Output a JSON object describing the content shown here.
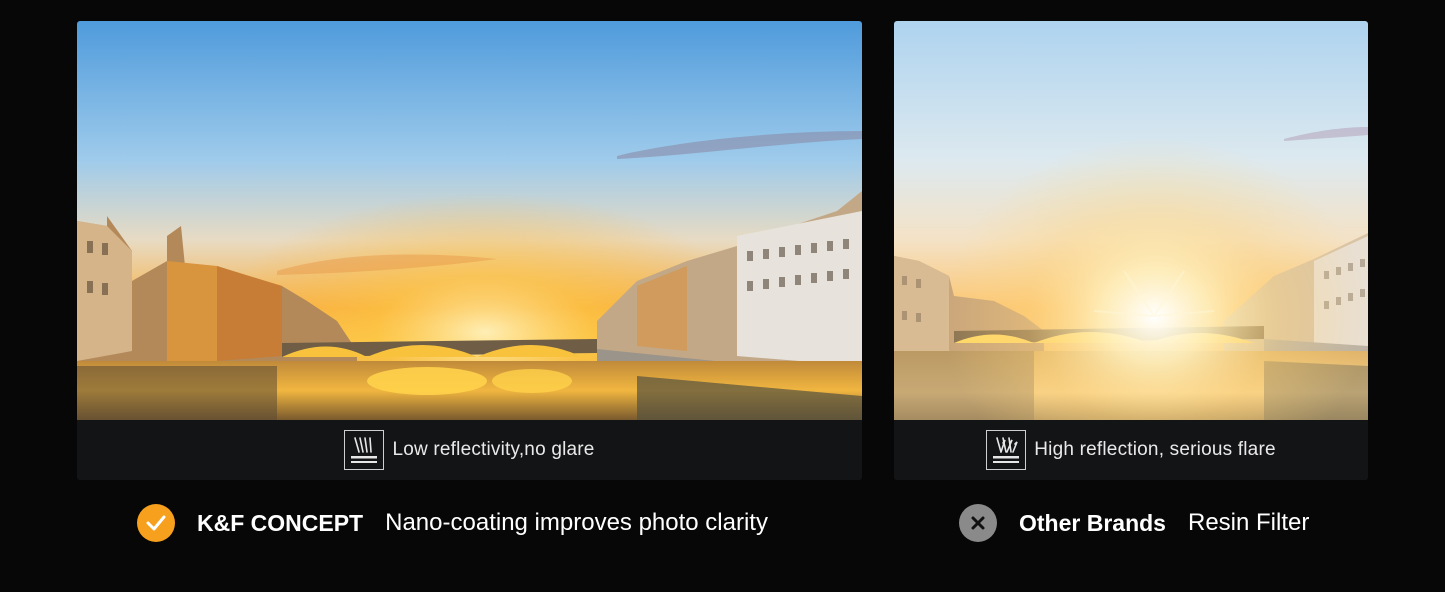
{
  "left_panel": {
    "image_alt": "City riverside at sunset with arched bridge, clear reflections",
    "caption_icon": "low-reflection-icon",
    "caption": "Low reflectivity,no glare"
  },
  "right_panel": {
    "image_alt": "City riverside at sunset with heavy flare and washed-out sky",
    "caption_icon": "high-reflection-icon",
    "caption": "High reflection, serious flare"
  },
  "bottom_left": {
    "icon": "check-icon",
    "brand": "K&F CONCEPT",
    "description": "Nano-coating improves photo clarity"
  },
  "bottom_right": {
    "icon": "cross-icon",
    "brand": "Other Brands",
    "description": "Resin Filter"
  },
  "colors": {
    "background": "#070707",
    "caption_bar": "#131416",
    "check_badge": "#f6a01d",
    "cross_badge": "#8a8a8a",
    "text": "#ffffff"
  }
}
